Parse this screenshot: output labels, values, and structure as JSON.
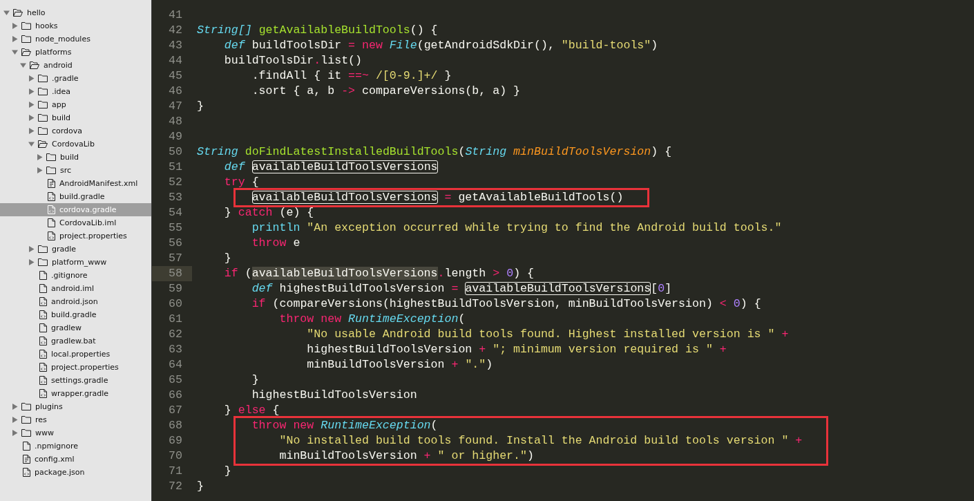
{
  "sidebar": {
    "tree": [
      {
        "label": "hello",
        "kind": "folder",
        "expanded": true,
        "selected": false,
        "children": [
          {
            "label": "hooks",
            "kind": "folder",
            "expanded": false,
            "selected": false
          },
          {
            "label": "node_modules",
            "kind": "folder",
            "expanded": false,
            "selected": false
          },
          {
            "label": "platforms",
            "kind": "folder",
            "expanded": true,
            "selected": false,
            "children": [
              {
                "label": "android",
                "kind": "folder",
                "expanded": true,
                "selected": false,
                "children": [
                  {
                    "label": ".gradle",
                    "kind": "folder",
                    "expanded": false,
                    "selected": false
                  },
                  {
                    "label": ".idea",
                    "kind": "folder",
                    "expanded": false,
                    "selected": false
                  },
                  {
                    "label": "app",
                    "kind": "folder",
                    "expanded": false,
                    "selected": false
                  },
                  {
                    "label": "build",
                    "kind": "folder",
                    "expanded": false,
                    "selected": false
                  },
                  {
                    "label": "cordova",
                    "kind": "folder",
                    "expanded": false,
                    "selected": false
                  },
                  {
                    "label": "CordovaLib",
                    "kind": "folder",
                    "expanded": true,
                    "selected": false,
                    "children": [
                      {
                        "label": "build",
                        "kind": "folder",
                        "expanded": false,
                        "selected": false
                      },
                      {
                        "label": "src",
                        "kind": "folder",
                        "expanded": false,
                        "selected": false
                      },
                      {
                        "label": "AndroidManifest.xml",
                        "kind": "doc-file",
                        "selected": false
                      },
                      {
                        "label": "build.gradle",
                        "kind": "code-file",
                        "selected": false
                      },
                      {
                        "label": "cordova.gradle",
                        "kind": "code-file",
                        "selected": true
                      },
                      {
                        "label": "CordovaLib.iml",
                        "kind": "file",
                        "selected": false
                      },
                      {
                        "label": "project.properties",
                        "kind": "code-file",
                        "selected": false
                      }
                    ]
                  },
                  {
                    "label": "gradle",
                    "kind": "folder",
                    "expanded": false,
                    "selected": false
                  },
                  {
                    "label": "platform_www",
                    "kind": "folder",
                    "expanded": false,
                    "selected": false
                  },
                  {
                    "label": ".gitignore",
                    "kind": "file",
                    "selected": false
                  },
                  {
                    "label": "android.iml",
                    "kind": "file",
                    "selected": false
                  },
                  {
                    "label": "android.json",
                    "kind": "code-file",
                    "selected": false
                  },
                  {
                    "label": "build.gradle",
                    "kind": "code-file",
                    "selected": false
                  },
                  {
                    "label": "gradlew",
                    "kind": "file",
                    "selected": false
                  },
                  {
                    "label": "gradlew.bat",
                    "kind": "code-file",
                    "selected": false
                  },
                  {
                    "label": "local.properties",
                    "kind": "code-file",
                    "selected": false
                  },
                  {
                    "label": "project.properties",
                    "kind": "code-file",
                    "selected": false
                  },
                  {
                    "label": "settings.gradle",
                    "kind": "code-file",
                    "selected": false
                  },
                  {
                    "label": "wrapper.gradle",
                    "kind": "code-file",
                    "selected": false
                  }
                ]
              }
            ]
          },
          {
            "label": "plugins",
            "kind": "folder",
            "expanded": false,
            "selected": false
          },
          {
            "label": "res",
            "kind": "folder",
            "expanded": false,
            "selected": false
          },
          {
            "label": "www",
            "kind": "folder",
            "expanded": false,
            "selected": false
          },
          {
            "label": ".npmignore",
            "kind": "file",
            "selected": false
          },
          {
            "label": "config.xml",
            "kind": "doc-file",
            "selected": false
          },
          {
            "label": "package.json",
            "kind": "code-file",
            "selected": false
          }
        ]
      }
    ]
  },
  "editor": {
    "blocks": [
      {
        "kind": "code",
        "lines": [
          {
            "number": "41",
            "current": false
          },
          {
            "number": "42",
            "current": false,
            "tokens": [
              {
                "kind": "type",
                "text": "String[] "
              },
              {
                "kind": "fn",
                "text": "getAvailableBuildTools"
              },
              {
                "kind": "plain",
                "text": "() {"
              }
            ]
          },
          {
            "number": "43",
            "current": false,
            "tokens": [
              {
                "kind": "type",
                "text": "    def"
              },
              {
                "kind": "plain",
                "text": " buildToolsDir "
              },
              {
                "kind": "kw",
                "text": "= new"
              },
              {
                "kind": "type",
                "text": " File"
              },
              {
                "kind": "plain",
                "text": "(getAndroidSdkDir(), "
              },
              {
                "kind": "str",
                "text": "\"build-tools\""
              },
              {
                "kind": "plain",
                "text": ")"
              }
            ]
          },
          {
            "number": "44",
            "current": false,
            "tokens": [
              {
                "kind": "plain",
                "text": "    buildToolsDir"
              },
              {
                "kind": "kw",
                "text": "."
              },
              {
                "kind": "plain",
                "text": "list()"
              }
            ]
          },
          {
            "number": "45",
            "current": false,
            "tokens": [
              {
                "kind": "plain",
                "text": "        .findAll { it "
              },
              {
                "kind": "kw",
                "text": "==~"
              },
              {
                "kind": "str",
                "text": " /[0-9.]+/"
              },
              {
                "kind": "plain",
                "text": " }"
              }
            ]
          },
          {
            "number": "46",
            "current": false,
            "tokens": [
              {
                "kind": "plain",
                "text": "        .sort { a, b "
              },
              {
                "kind": "kw",
                "text": "->"
              },
              {
                "kind": "plain",
                "text": " compareVersions(b, a) }"
              }
            ]
          },
          {
            "number": "47",
            "current": false,
            "tokens": [
              {
                "kind": "plain",
                "text": "}"
              }
            ]
          },
          {
            "number": "48",
            "current": false
          },
          {
            "number": "49",
            "current": false
          },
          {
            "number": "50",
            "current": false,
            "tokens": [
              {
                "kind": "type",
                "text": "String "
              },
              {
                "kind": "fn",
                "text": "doFindLatestInstalledBuildTools"
              },
              {
                "kind": "plain",
                "text": "("
              },
              {
                "kind": "type",
                "text": "String "
              },
              {
                "kind": "param",
                "text": "minBuildToolsVersion"
              },
              {
                "kind": "plain",
                "text": ") {"
              }
            ]
          },
          {
            "number": "51",
            "current": false,
            "tokens": [
              {
                "kind": "type",
                "text": "    def"
              },
              {
                "kind": "boxed",
                "text": " availableBuildToolsVersions"
              }
            ]
          },
          {
            "number": "52",
            "current": false,
            "tokens": [
              {
                "kind": "kw",
                "text": "    try"
              },
              {
                "kind": "plain",
                "text": " {"
              }
            ]
          }
        ]
      },
      {
        "kind": "red-box",
        "lines": [
          {
            "number": "53",
            "current": false,
            "tokens": [
              {
                "kind": "boxed",
                "text": "        availableBuildToolsVersions"
              },
              {
                "kind": "kw",
                "text": " ="
              },
              {
                "kind": "plain",
                "text": " getAvailableBuildTools()"
              }
            ]
          }
        ]
      },
      {
        "kind": "code",
        "lines": [
          {
            "number": "54",
            "current": false,
            "tokens": [
              {
                "kind": "plain",
                "text": "    } "
              },
              {
                "kind": "kw",
                "text": "catch"
              },
              {
                "kind": "plain",
                "text": " (e) {"
              }
            ]
          },
          {
            "number": "55",
            "current": false,
            "tokens": [
              {
                "kind": "builtin",
                "text": "        println"
              },
              {
                "kind": "str",
                "text": " \"An exception occurred while trying to find the Android build tools.\""
              }
            ]
          },
          {
            "number": "56",
            "current": false,
            "tokens": [
              {
                "kind": "kw",
                "text": "        throw"
              },
              {
                "kind": "plain",
                "text": " e"
              }
            ]
          },
          {
            "number": "57",
            "current": false,
            "tokens": [
              {
                "kind": "plain",
                "text": "    }"
              }
            ]
          },
          {
            "number": "58",
            "current": true,
            "tokens": [
              {
                "kind": "kw",
                "text": "    if"
              },
              {
                "kind": "plain",
                "text": " ("
              },
              {
                "kind": "selected",
                "text": "availableBuildToolsVersions"
              },
              {
                "kind": "kw",
                "text": "."
              },
              {
                "kind": "plain",
                "text": "length "
              },
              {
                "kind": "kw",
                "text": ">"
              },
              {
                "kind": "num",
                "text": " 0"
              },
              {
                "kind": "plain",
                "text": ") {"
              }
            ]
          },
          {
            "number": "59",
            "current": false,
            "tokens": [
              {
                "kind": "type",
                "text": "        def"
              },
              {
                "kind": "plain",
                "text": " highestBuildToolsVersion "
              },
              {
                "kind": "kw",
                "text": "="
              },
              {
                "kind": "boxed",
                "text": " availableBuildToolsVersions"
              },
              {
                "kind": "plain",
                "text": "["
              },
              {
                "kind": "num",
                "text": "0"
              },
              {
                "kind": "plain",
                "text": "]"
              }
            ]
          },
          {
            "number": "60",
            "current": false,
            "tokens": [
              {
                "kind": "kw",
                "text": "        if"
              },
              {
                "kind": "plain",
                "text": " (compareVersions(highestBuildToolsVersion, minBuildToolsVersion) "
              },
              {
                "kind": "kw",
                "text": "<"
              },
              {
                "kind": "num",
                "text": " 0"
              },
              {
                "kind": "plain",
                "text": ") {"
              }
            ]
          },
          {
            "number": "61",
            "current": false,
            "tokens": [
              {
                "kind": "kw",
                "text": "            throw new"
              },
              {
                "kind": "type",
                "text": " RuntimeException"
              },
              {
                "kind": "plain",
                "text": "("
              }
            ]
          },
          {
            "number": "62",
            "current": false,
            "tokens": [
              {
                "kind": "str",
                "text": "                \"No usable Android build tools found. Highest installed version is \""
              },
              {
                "kind": "kw",
                "text": " +"
              }
            ]
          },
          {
            "number": "63",
            "current": false,
            "tokens": [
              {
                "kind": "plain",
                "text": "                highestBuildToolsVersion "
              },
              {
                "kind": "kw",
                "text": "+"
              },
              {
                "kind": "str",
                "text": " \"; minimum version required is \""
              },
              {
                "kind": "kw",
                "text": " +"
              }
            ]
          },
          {
            "number": "64",
            "current": false,
            "tokens": [
              {
                "kind": "plain",
                "text": "                minBuildToolsVersion "
              },
              {
                "kind": "kw",
                "text": "+"
              },
              {
                "kind": "str",
                "text": " \".\""
              },
              {
                "kind": "plain",
                "text": ")"
              }
            ]
          },
          {
            "number": "65",
            "current": false,
            "tokens": [
              {
                "kind": "plain",
                "text": "        }"
              }
            ]
          },
          {
            "number": "66",
            "current": false,
            "tokens": [
              {
                "kind": "plain",
                "text": "        highestBuildToolsVersion"
              }
            ]
          },
          {
            "number": "67",
            "current": false,
            "tokens": [
              {
                "kind": "plain",
                "text": "    } "
              },
              {
                "kind": "kw",
                "text": "else"
              },
              {
                "kind": "plain",
                "text": " {"
              }
            ]
          }
        ]
      },
      {
        "kind": "red-box",
        "lines": [
          {
            "number": "68",
            "current": false,
            "tokens": [
              {
                "kind": "kw",
                "text": "        throw new"
              },
              {
                "kind": "type",
                "text": " RuntimeException"
              },
              {
                "kind": "plain",
                "text": "("
              }
            ]
          },
          {
            "number": "69",
            "current": false,
            "tokens": [
              {
                "kind": "str",
                "text": "            \"No installed build tools found. Install the Android build tools version \""
              },
              {
                "kind": "kw",
                "text": " +"
              }
            ]
          },
          {
            "number": "70",
            "current": false,
            "tokens": [
              {
                "kind": "plain",
                "text": "            minBuildToolsVersion "
              },
              {
                "kind": "kw",
                "text": "+"
              },
              {
                "kind": "str",
                "text": " \" or higher.\""
              },
              {
                "kind": "plain",
                "text": ")"
              }
            ]
          }
        ]
      },
      {
        "kind": "code",
        "lines": [
          {
            "number": "71",
            "current": false,
            "tokens": [
              {
                "kind": "plain",
                "text": "    }"
              }
            ]
          },
          {
            "number": "72",
            "current": false,
            "tokens": [
              {
                "kind": "plain",
                "text": "}"
              }
            ]
          }
        ]
      }
    ]
  }
}
